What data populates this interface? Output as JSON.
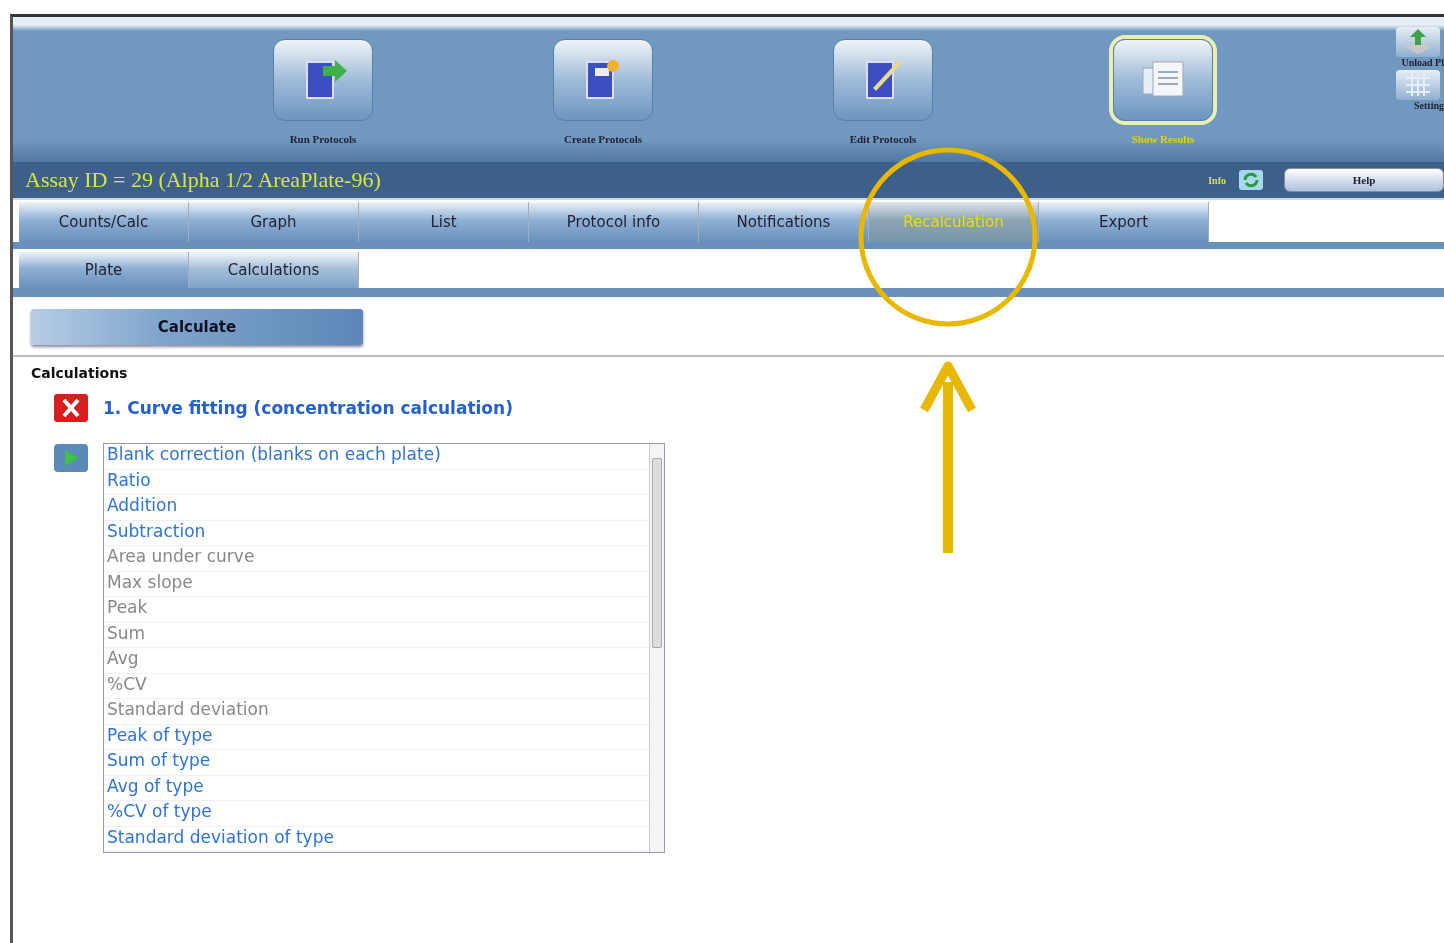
{
  "toolbar": {
    "buttons": [
      {
        "label": "Run Protocols",
        "selected": false,
        "kind": "run"
      },
      {
        "label": "Create Protocols",
        "selected": false,
        "kind": "create"
      },
      {
        "label": "Edit Protocols",
        "selected": false,
        "kind": "edit"
      },
      {
        "label": "Show Results",
        "selected": true,
        "kind": "results"
      }
    ],
    "side_buttons": [
      {
        "label": "Unload Pl",
        "kind": "unload"
      },
      {
        "label": "Setting",
        "kind": "settings"
      }
    ]
  },
  "title_bar": {
    "title": "Assay ID = 29 (Alpha 1/2 AreaPlate-96)",
    "info": "Info",
    "help": "Help"
  },
  "tabs": [
    {
      "label": "Counts/Calc",
      "selected": false
    },
    {
      "label": "Graph",
      "selected": false
    },
    {
      "label": "List",
      "selected": false
    },
    {
      "label": "Protocol info",
      "selected": false
    },
    {
      "label": "Notifications",
      "selected": false
    },
    {
      "label": "Recalculation",
      "selected": true
    },
    {
      "label": "Export",
      "selected": false
    }
  ],
  "subtabs": [
    {
      "label": "Plate",
      "selected": false
    },
    {
      "label": "Calculations",
      "selected": true
    }
  ],
  "calculate_button": "Calculate",
  "calculations": {
    "heading": "Calculations",
    "steps": [
      {
        "label": "1. Curve fitting (concentration calculation)",
        "kind": "remove"
      }
    ],
    "options": [
      {
        "label": "Blank correction (blanks on each plate)",
        "disabled": false
      },
      {
        "label": "Ratio",
        "disabled": false
      },
      {
        "label": "Addition",
        "disabled": false
      },
      {
        "label": "Subtraction",
        "disabled": false
      },
      {
        "label": "Area under curve",
        "disabled": true
      },
      {
        "label": "Max slope",
        "disabled": true
      },
      {
        "label": "Peak",
        "disabled": true
      },
      {
        "label": "Sum",
        "disabled": true
      },
      {
        "label": "Avg",
        "disabled": true
      },
      {
        "label": "%CV",
        "disabled": true
      },
      {
        "label": "Standard deviation",
        "disabled": true
      },
      {
        "label": "Peak of type",
        "disabled": false
      },
      {
        "label": "Sum of type",
        "disabled": false
      },
      {
        "label": "Avg of type",
        "disabled": false
      },
      {
        "label": "%CV of type",
        "disabled": false
      },
      {
        "label": "Standard deviation of type",
        "disabled": false
      }
    ]
  }
}
